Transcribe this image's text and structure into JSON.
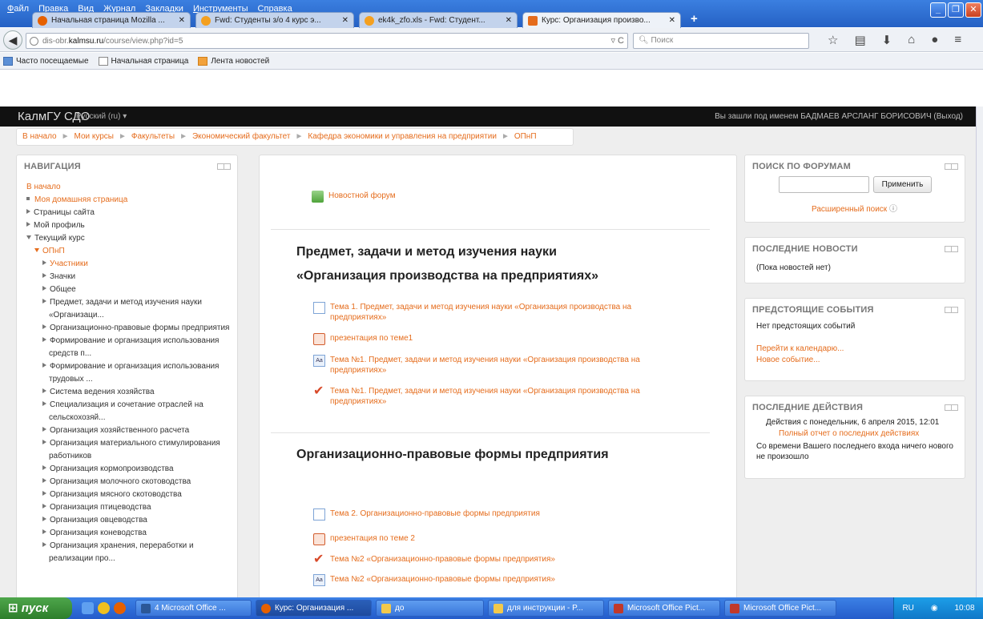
{
  "browser": {
    "menu": [
      "Файл",
      "Правка",
      "Вид",
      "Журнал",
      "Закладки",
      "Инструменты",
      "Справка"
    ],
    "tabs": [
      {
        "label": "Начальная страница Mozilla ...",
        "active": false,
        "color": "#e66000"
      },
      {
        "label": "Fwd: Студенты з/о 4 курс э...",
        "active": false,
        "color": "#f4a020"
      },
      {
        "label": "ek4k_zfo.xls - Fwd: Студент...",
        "active": false,
        "color": "#f4a020"
      },
      {
        "label": "Курс: Организация произво...",
        "active": true,
        "color": "#e56c1c"
      }
    ],
    "tab_close": "✕",
    "new_tab": "+",
    "url_prefix": "dis-obr.",
    "url_domain": "kalmsu.ru",
    "url_path": "/course/view.php?id=5",
    "search_placeholder": "Поиск",
    "bookmarks": [
      "Часто посещаемые",
      "Начальная страница",
      "Лента новостей"
    ]
  },
  "moodle": {
    "brand": "КалмГУ СДО",
    "language": "Русский (ru) ▾",
    "login_info": "Вы зашли под именем БАДМАЕВ АРСЛАНГ БОРИСОВИЧ (Выход)",
    "breadcrumb": [
      "В начало",
      "Мои курсы",
      "Факультеты",
      "Экономический факультет",
      "Кафедра экономики и управления на предприятии",
      "ОПнП"
    ],
    "breadcrumb_sep": "►"
  },
  "navigation": {
    "title": "НАВИГАЦИЯ",
    "home": "В начало",
    "my_home": "Моя домашняя страница",
    "site_pages": "Страницы сайта",
    "my_profile": "Мой профиль",
    "current_course": "Текущий курс",
    "course": "ОПнП",
    "course_items": [
      "Участники",
      "Значки",
      "Общее",
      "Предмет, задачи и метод изучения науки «Организаци...",
      "Организационно-правовые формы предприятия",
      "Формирование и организация использования средств п...",
      "Формирование и организация использования трудовых ...",
      "Система ведения хозяйства",
      "Специализация и сочетание отраслей на сельскохозяй...",
      "Организация хозяйственного расчета",
      "Организация материального стимулирования работников",
      "Организация кормопроизводства",
      "Организация молочного скотоводства",
      "Организация мясного скотоводства",
      "Организация птицеводства",
      "Организация овцеводства",
      "Организация коневодства",
      "Организация хранения, переработки и реализации про..."
    ]
  },
  "main": {
    "news_forum": "Новостной форум",
    "section1_title_line1": "Предмет, задачи и метод изучения науки",
    "section1_title_line2": "«Организация производства на предприятиях»",
    "section1_items": [
      "Тема 1. Предмет, задачи и метод изучения науки «Организация производства на предприятиях»",
      "презентация по теме1",
      "Тема №1. Предмет, задачи и метод изучения науки «Организация производства на предприятиях»",
      "Тема №1. Предмет, задачи и метод изучения науки «Организация производства на предприятиях»"
    ],
    "section2_title": "Организационно-правовые формы предприятия",
    "section2_items": [
      "Тема 2. Организационно-правовые формы предприятия",
      "презентация по теме 2",
      "Тема №2 «Организационно-правовые формы предприятия»",
      "Тема №2 «Организационно-правовые формы предприятия»"
    ]
  },
  "forum_search": {
    "title": "ПОИСК ПО ФОРУМАМ",
    "input_value": "",
    "apply": "Применить",
    "advanced": "Расширенный поиск"
  },
  "latest_news": {
    "title": "ПОСЛЕДНИЕ НОВОСТИ",
    "text": "(Пока новостей нет)"
  },
  "upcoming_events": {
    "title": "ПРЕДСТОЯЩИЕ СОБЫТИЯ",
    "text": "Нет предстоящих событий",
    "go_calendar": "Перейти к календарю...",
    "new_event": "Новое событие..."
  },
  "recent_activity": {
    "title": "ПОСЛЕДНИЕ ДЕЙСТВИЯ",
    "since": "Действия с понедельник, 6 апреля 2015, 12:01",
    "full_report": "Полный отчет о последних действиях",
    "nothing_new": "Со времени Вашего последнего входа ничего нового не произошло"
  },
  "taskbar": {
    "start": "пуск",
    "buttons": [
      "4 Microsoft Office ...",
      "Курс: Организация ...",
      "до",
      "для инструкции - P...",
      "Microsoft Office Pict...",
      "Microsoft Office Pict..."
    ],
    "lang": "RU",
    "clock": "10:08"
  },
  "colors": {
    "accent": "#e56c1c",
    "header": "#111111",
    "taskbar": "#245ccb"
  }
}
